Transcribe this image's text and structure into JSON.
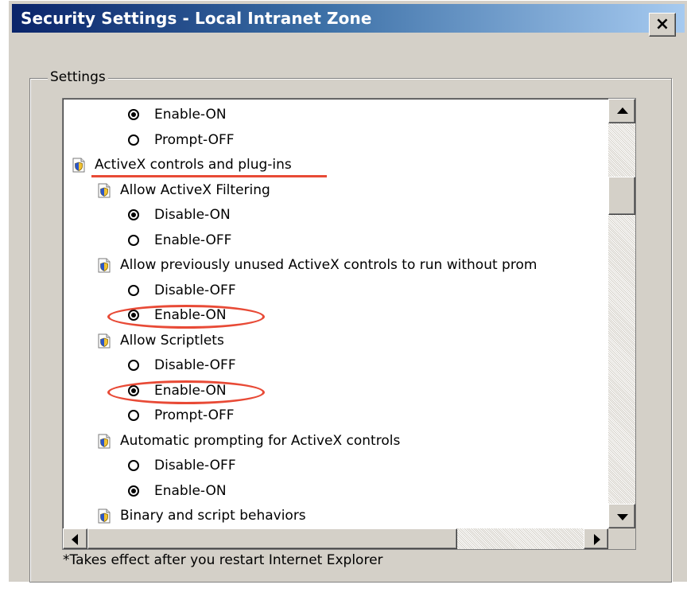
{
  "window": {
    "title": "Security Settings - Local Intranet Zone",
    "close_glyph": "×"
  },
  "group": {
    "label": "Settings"
  },
  "tree": [
    {
      "kind": "option",
      "label": "Enable-ON",
      "checked": true,
      "indent": 2
    },
    {
      "kind": "option",
      "label": "Prompt-OFF",
      "checked": false,
      "indent": 2
    },
    {
      "kind": "category",
      "label": "ActiveX controls and plug-ins",
      "indent": 0,
      "underlined": true
    },
    {
      "kind": "setting",
      "label": "Allow ActiveX Filtering",
      "indent": 1
    },
    {
      "kind": "option",
      "label": "Disable-ON",
      "checked": true,
      "indent": 2
    },
    {
      "kind": "option",
      "label": "Enable-OFF",
      "checked": false,
      "indent": 2
    },
    {
      "kind": "setting",
      "label": "Allow previously unused ActiveX controls to run without prom",
      "indent": 1
    },
    {
      "kind": "option",
      "label": "Disable-OFF",
      "checked": false,
      "indent": 2
    },
    {
      "kind": "option",
      "label": "Enable-ON",
      "checked": true,
      "indent": 2,
      "circled": true
    },
    {
      "kind": "setting",
      "label": "Allow Scriptlets",
      "indent": 1
    },
    {
      "kind": "option",
      "label": "Disable-OFF",
      "checked": false,
      "indent": 2
    },
    {
      "kind": "option",
      "label": "Enable-ON",
      "checked": true,
      "indent": 2,
      "circled": true
    },
    {
      "kind": "option",
      "label": "Prompt-OFF",
      "checked": false,
      "indent": 2
    },
    {
      "kind": "setting",
      "label": "Automatic prompting for ActiveX controls",
      "indent": 1
    },
    {
      "kind": "option",
      "label": "Disable-OFF",
      "checked": false,
      "indent": 2
    },
    {
      "kind": "option",
      "label": "Enable-ON",
      "checked": true,
      "indent": 2
    },
    {
      "kind": "setting",
      "label": "Binary and script behaviors",
      "indent": 1
    }
  ],
  "footer": {
    "note": "*Takes effect after you restart Internet Explorer"
  },
  "colors": {
    "titlebar_start": "#0a246a",
    "titlebar_end": "#a6caf0",
    "annotation_red": "#e84a36",
    "dialog_face": "#d4d0c8"
  },
  "icons": {
    "setting": "shield-page-icon",
    "category": "shield-page-icon"
  }
}
